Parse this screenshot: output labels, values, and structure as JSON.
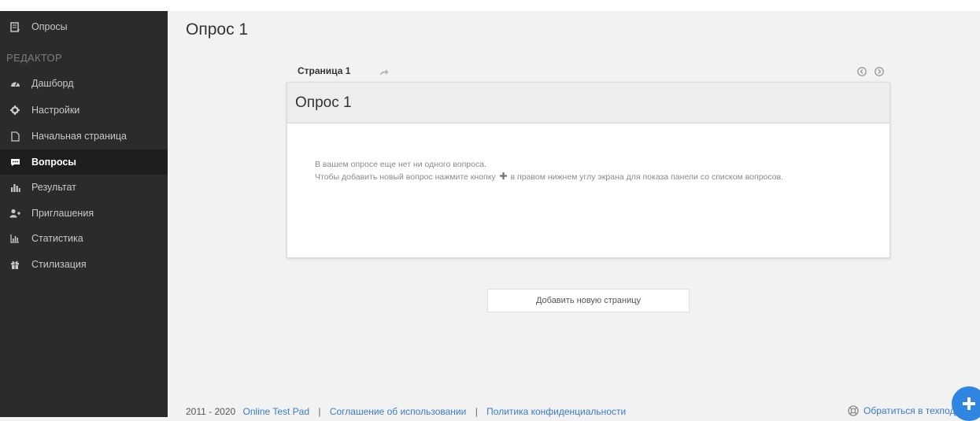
{
  "page": {
    "title": "Опрос 1"
  },
  "sidebar": {
    "top_item": "Опросы",
    "section": "РЕДАКТОР",
    "items": [
      {
        "label": "Дашборд",
        "icon": "dashboard-icon"
      },
      {
        "label": "Настройки",
        "icon": "gear-icon"
      },
      {
        "label": "Начальная страница",
        "icon": "file-icon"
      },
      {
        "label": "Вопросы",
        "icon": "comment-icon",
        "active": true
      },
      {
        "label": "Результат",
        "icon": "bar-chart-icon"
      },
      {
        "label": "Приглашения",
        "icon": "add-user-icon"
      },
      {
        "label": "Статистика",
        "icon": "stats-icon"
      },
      {
        "label": "Стилизация",
        "icon": "gift-icon"
      }
    ]
  },
  "editor": {
    "page_tab": "Страница 1",
    "card_title": "Опрос 1",
    "empty_line1": "В вашем опросе еще нет ни одного вопроса.",
    "empty_line2_a": "Чтобы добавить новый вопрос нажмите кнопку",
    "empty_line2_b": "в правом нижнем углу экрана для показа панели со списком вопросов.",
    "add_page": "Добавить новую страницу"
  },
  "footer": {
    "years": "2011 - 2020",
    "brand": "Online Test Pad",
    "link1": "Соглашение об использовании",
    "link2": "Политика конфиденциальности",
    "separator": "|",
    "support": "Обратиться в техподд"
  },
  "colors": {
    "sidebar_bg": "#2b2b2b",
    "accent": "#2f86e0",
    "link": "#3a7bc8"
  }
}
